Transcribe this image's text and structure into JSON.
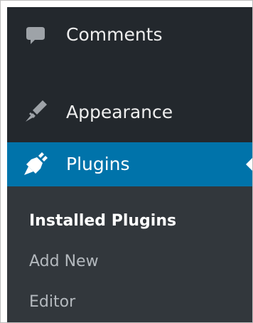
{
  "menu": {
    "items": [
      {
        "id": "comments",
        "label": "Comments",
        "icon": "comment-icon"
      },
      {
        "id": "appearance",
        "label": "Appearance",
        "icon": "paintbrush-icon"
      },
      {
        "id": "plugins",
        "label": "Plugins",
        "icon": "plug-icon",
        "current": true
      }
    ],
    "submenu": [
      {
        "label": "Installed Plugins",
        "current": true
      },
      {
        "label": "Add New"
      },
      {
        "label": "Editor"
      }
    ]
  },
  "colors": {
    "menu_background": "#23282d",
    "submenu_background": "#32373c",
    "highlight": "#0073aa",
    "text": "#eeeeee",
    "muted_text": "#b4b9be"
  }
}
